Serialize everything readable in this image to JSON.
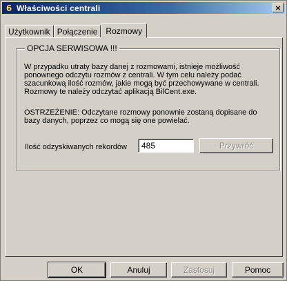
{
  "window": {
    "title": "Właściwości centrali",
    "app_icon": "6",
    "close_glyph": "×"
  },
  "tabs": [
    {
      "label": "Użytkownik",
      "active": false
    },
    {
      "label": "Połączenie",
      "active": false
    },
    {
      "label": "Rozmowy",
      "active": true
    }
  ],
  "group": {
    "title": "OPCJA SERWISOWA !!!",
    "paragraph1": "W przypadku utraty bazy danej z rozmowami, istnieje możliwość ponownego odczytu rozmów z centrali. W tym celu należy podać szacunkową ilość rozmów, jakie mogą być przechowywane w centrali. Rozmowy te należy odczytać aplikacją BilCent.exe.",
    "paragraph2": "OSTRZEŻENIE: Odczytane rozmowy ponownie zostaną dopisane do bazy danych, poprzez co mogą się one powielać.",
    "records_label": "Ilość odzyskiwanych rekordów",
    "records_value": "485",
    "recover_button": "Przywróć"
  },
  "footer": {
    "ok": "OK",
    "cancel": "Anuluj",
    "apply": "Zastosuj",
    "help": "Pomoc"
  }
}
